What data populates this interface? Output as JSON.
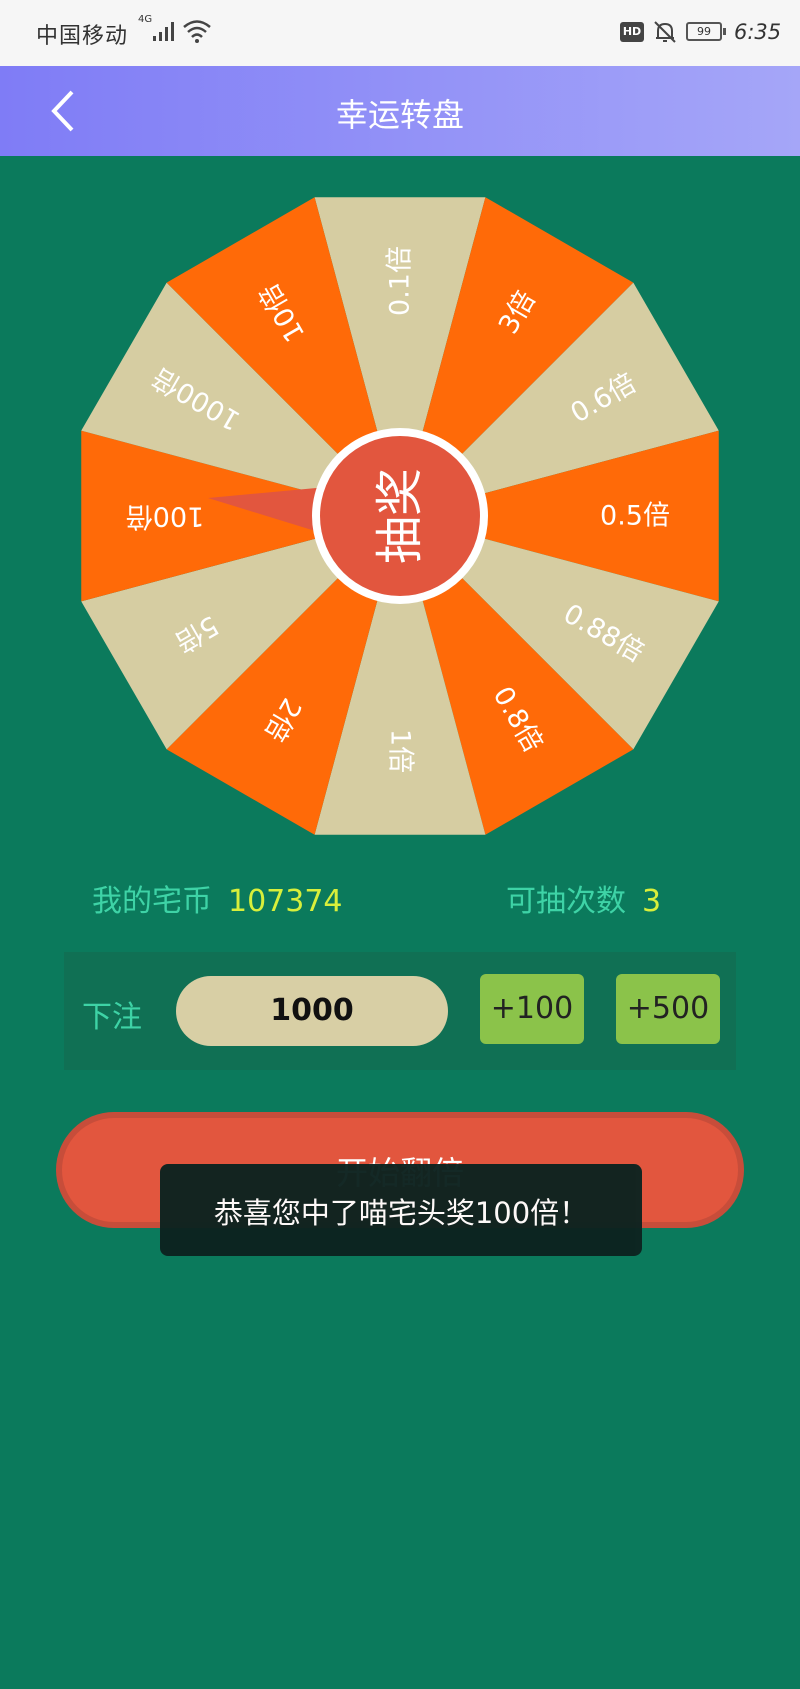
{
  "status_bar": {
    "carrier": "中国移动",
    "network": "4G",
    "hd": "HD",
    "battery": "99",
    "time": "6:35"
  },
  "app_bar": {
    "back_icon": "chevron-left-icon",
    "title": "幸运转盘"
  },
  "wheel": {
    "center_label": "抽奖",
    "colors": {
      "orange": "#ff6a08",
      "beige": "#d6cda2",
      "center": "#e2563e"
    },
    "segments": [
      "0.1倍",
      "3倍",
      "0.6倍",
      "0.5倍",
      "0.88倍",
      "0.8倍",
      "1倍",
      "2倍",
      "5倍",
      "100倍",
      "1000倍",
      "10倍"
    ]
  },
  "stats": {
    "coins_label": "我的宅币",
    "coins_value": "107374",
    "draws_label": "可抽次数",
    "draws_value": "3"
  },
  "bet": {
    "label": "下注",
    "amount": "1000",
    "add_small": "+100",
    "add_large": "+500"
  },
  "start_button": {
    "label": "开始翻倍"
  },
  "toast": {
    "message": "恭喜您中了喵宅头奖100倍！"
  }
}
